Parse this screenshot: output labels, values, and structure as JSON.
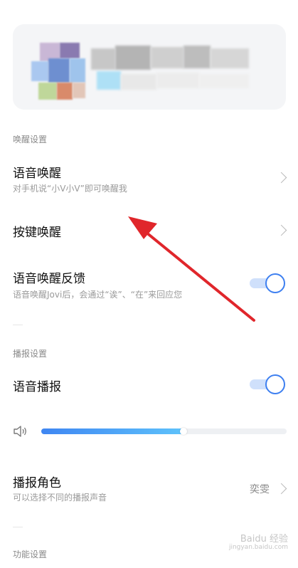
{
  "sections": {
    "wake": "唤醒设置",
    "broadcast": "播报设置",
    "function": "功能设置"
  },
  "rows": {
    "voice_wake": {
      "title": "语音唤醒",
      "subtitle": "对手机说“小V小V”即可唤醒我"
    },
    "button_wake": {
      "title": "按键唤醒"
    },
    "voice_wake_feedback": {
      "title": "语音唤醒反馈",
      "subtitle": "语音唤醒Jovi后，会通过“诶”、“在”来回应您",
      "enabled": true
    },
    "voice_broadcast": {
      "title": "语音播报",
      "enabled": true
    },
    "broadcast_role": {
      "title": "播报角色",
      "subtitle": "可以选择不同的播报声音",
      "value": "奕雯"
    }
  },
  "volume": {
    "level_percent": 58
  },
  "watermark": {
    "text": "Baidu 经验",
    "domain": "jingyan.baidu.com"
  },
  "colors": {
    "accent": "#3d7ff0",
    "arrow": "#e0262b"
  }
}
